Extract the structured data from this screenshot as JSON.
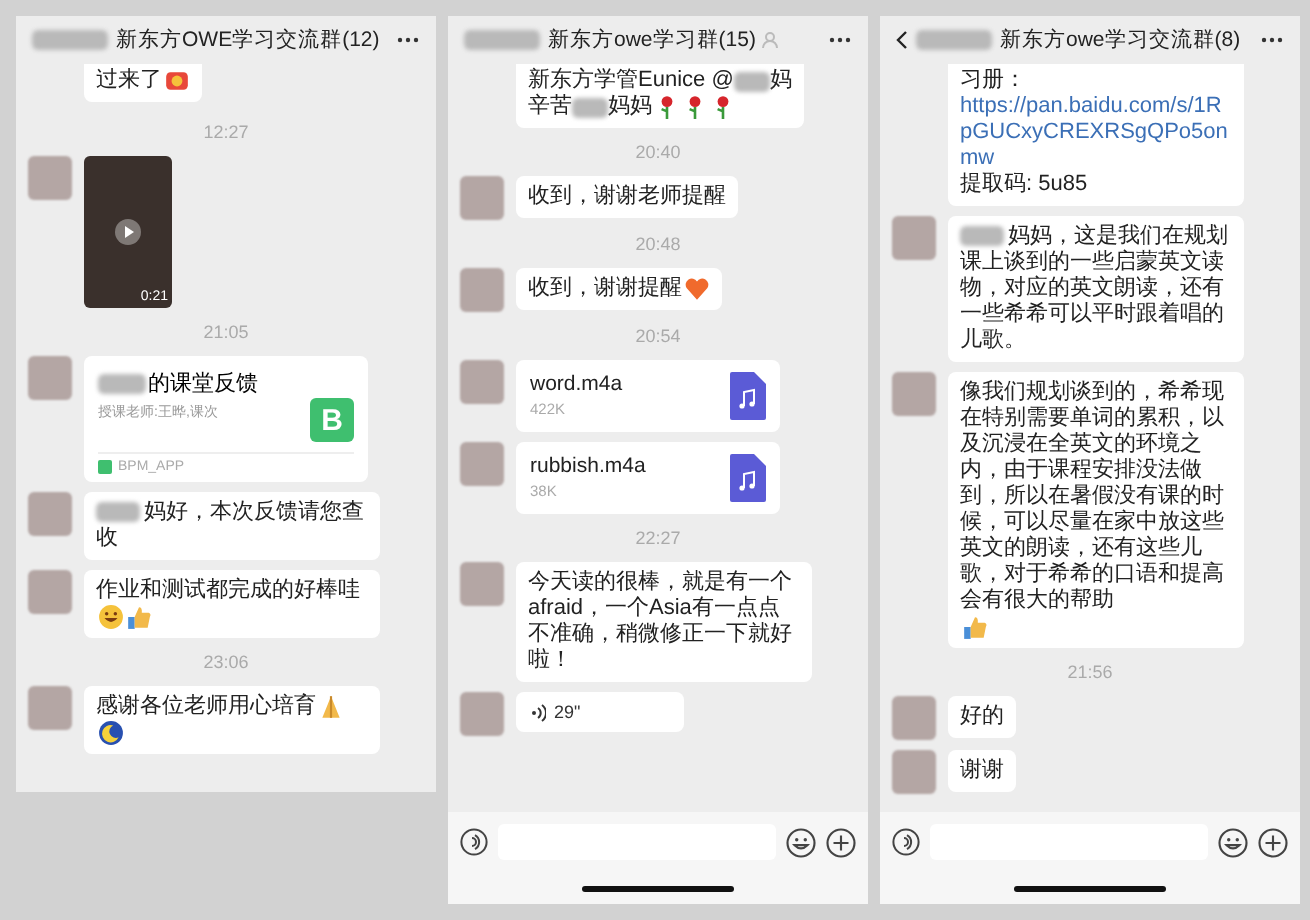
{
  "panels": [
    {
      "title": "新东方OWE学习交流群(12)",
      "back_visible": false,
      "member_icon": false,
      "input_bar": false,
      "messages": [
        {
          "kind": "text",
          "partial": true,
          "segments": [
            {
              "kind": "text",
              "text": "过来了"
            },
            {
              "kind": "blush"
            }
          ]
        },
        {
          "kind": "time",
          "text": "12:27"
        },
        {
          "kind": "video",
          "duration": "0:21"
        },
        {
          "kind": "time",
          "text": "21:05"
        },
        {
          "kind": "card",
          "title_redacted": true,
          "title": "的课堂反馈",
          "subtitle": "授课老师:王晔,课次",
          "app_letter": "B",
          "source": "BPM_APP"
        },
        {
          "kind": "text",
          "partial": false,
          "segments": [
            {
              "kind": "text",
              "redacted_prefix": true,
              "text": "妈好，本次反馈请您查收"
            }
          ]
        },
        {
          "kind": "text",
          "partial": false,
          "segments": [
            {
              "kind": "text",
              "text": "作业和测试都完成的好棒哇"
            },
            {
              "kind": "grin"
            },
            {
              "kind": "thumbs-up"
            }
          ]
        },
        {
          "kind": "time",
          "text": "23:06"
        },
        {
          "kind": "text",
          "partial": false,
          "segments": [
            {
              "kind": "text",
              "text": "感谢各位老师用心培育"
            },
            {
              "kind": "pray"
            },
            {
              "kind": "moon"
            }
          ]
        }
      ]
    },
    {
      "title": "新东方owe学习群(15)",
      "back_visible": false,
      "member_icon": true,
      "input_bar": true,
      "messages": [
        {
          "kind": "text",
          "partial": true,
          "segments": [
            {
              "kind": "text",
              "text": "新东方学管Eunice @"
            },
            {
              "kind": "redacted"
            },
            {
              "kind": "text",
              "text": "妈"
            },
            {
              "kind": "break"
            },
            {
              "kind": "text",
              "text": "辛苦"
            },
            {
              "kind": "redacted"
            },
            {
              "kind": "text",
              "text": "妈妈"
            },
            {
              "kind": "rose"
            },
            {
              "kind": "rose"
            },
            {
              "kind": "rose"
            }
          ]
        },
        {
          "kind": "time",
          "text": "20:40"
        },
        {
          "kind": "text",
          "partial": false,
          "segments": [
            {
              "kind": "text",
              "text": "收到，谢谢老师提醒"
            }
          ]
        },
        {
          "kind": "time",
          "text": "20:48"
        },
        {
          "kind": "text",
          "partial": false,
          "segments": [
            {
              "kind": "text",
              "text": "收到，谢谢提醒"
            },
            {
              "kind": "heart"
            }
          ]
        },
        {
          "kind": "time",
          "text": "20:54"
        },
        {
          "kind": "file",
          "name": "word.m4a",
          "size": "422K"
        },
        {
          "kind": "file",
          "name": "rubbish.m4a",
          "size": "38K"
        },
        {
          "kind": "time",
          "text": "22:27"
        },
        {
          "kind": "text",
          "partial": false,
          "segments": [
            {
              "kind": "text",
              "text": "今天读的很棒，就是有一个afraid，一个Asia有一点点不准确，稍微修正一下就好啦！"
            }
          ]
        },
        {
          "kind": "voice",
          "duration": "29\""
        }
      ]
    },
    {
      "title": "新东方owe学习交流群(8)",
      "back_visible": true,
      "member_icon": false,
      "input_bar": true,
      "messages": [
        {
          "kind": "text",
          "partial": true,
          "segments": [
            {
              "kind": "text",
              "text": "习册："
            },
            {
              "kind": "link",
              "text": "https://pan.baidu.com/s/1RpGUCxyCREXRSgQPo5onmw"
            },
            {
              "kind": "text",
              "text": "提取码: 5u85"
            }
          ]
        },
        {
          "kind": "text",
          "partial": false,
          "segments": [
            {
              "kind": "text",
              "redacted_prefix": true,
              "text": "妈妈，这是我们在规划课上谈到的一些启蒙英文读物，对应的英文朗读，还有一些希希可以平时跟着唱的儿歌。"
            }
          ]
        },
        {
          "kind": "text",
          "partial": false,
          "segments": [
            {
              "kind": "text",
              "text": "像我们规划谈到的，希希现在特别需要单词的累积，以及沉浸在全英文的环境之内，由于课程安排没法做到，所以在暑假没有课的时候，可以尽量在家中放这些英文的朗读，还有这些儿歌，对于希希的口语和提高会有很大的帮助"
            },
            {
              "kind": "thumbs-up"
            }
          ]
        },
        {
          "kind": "time",
          "text": "21:56"
        },
        {
          "kind": "text",
          "partial": false,
          "segments": [
            {
              "kind": "text",
              "text": "好的"
            }
          ]
        },
        {
          "kind": "text",
          "partial": false,
          "segments": [
            {
              "kind": "text",
              "text": "谢谢"
            }
          ]
        }
      ]
    }
  ]
}
